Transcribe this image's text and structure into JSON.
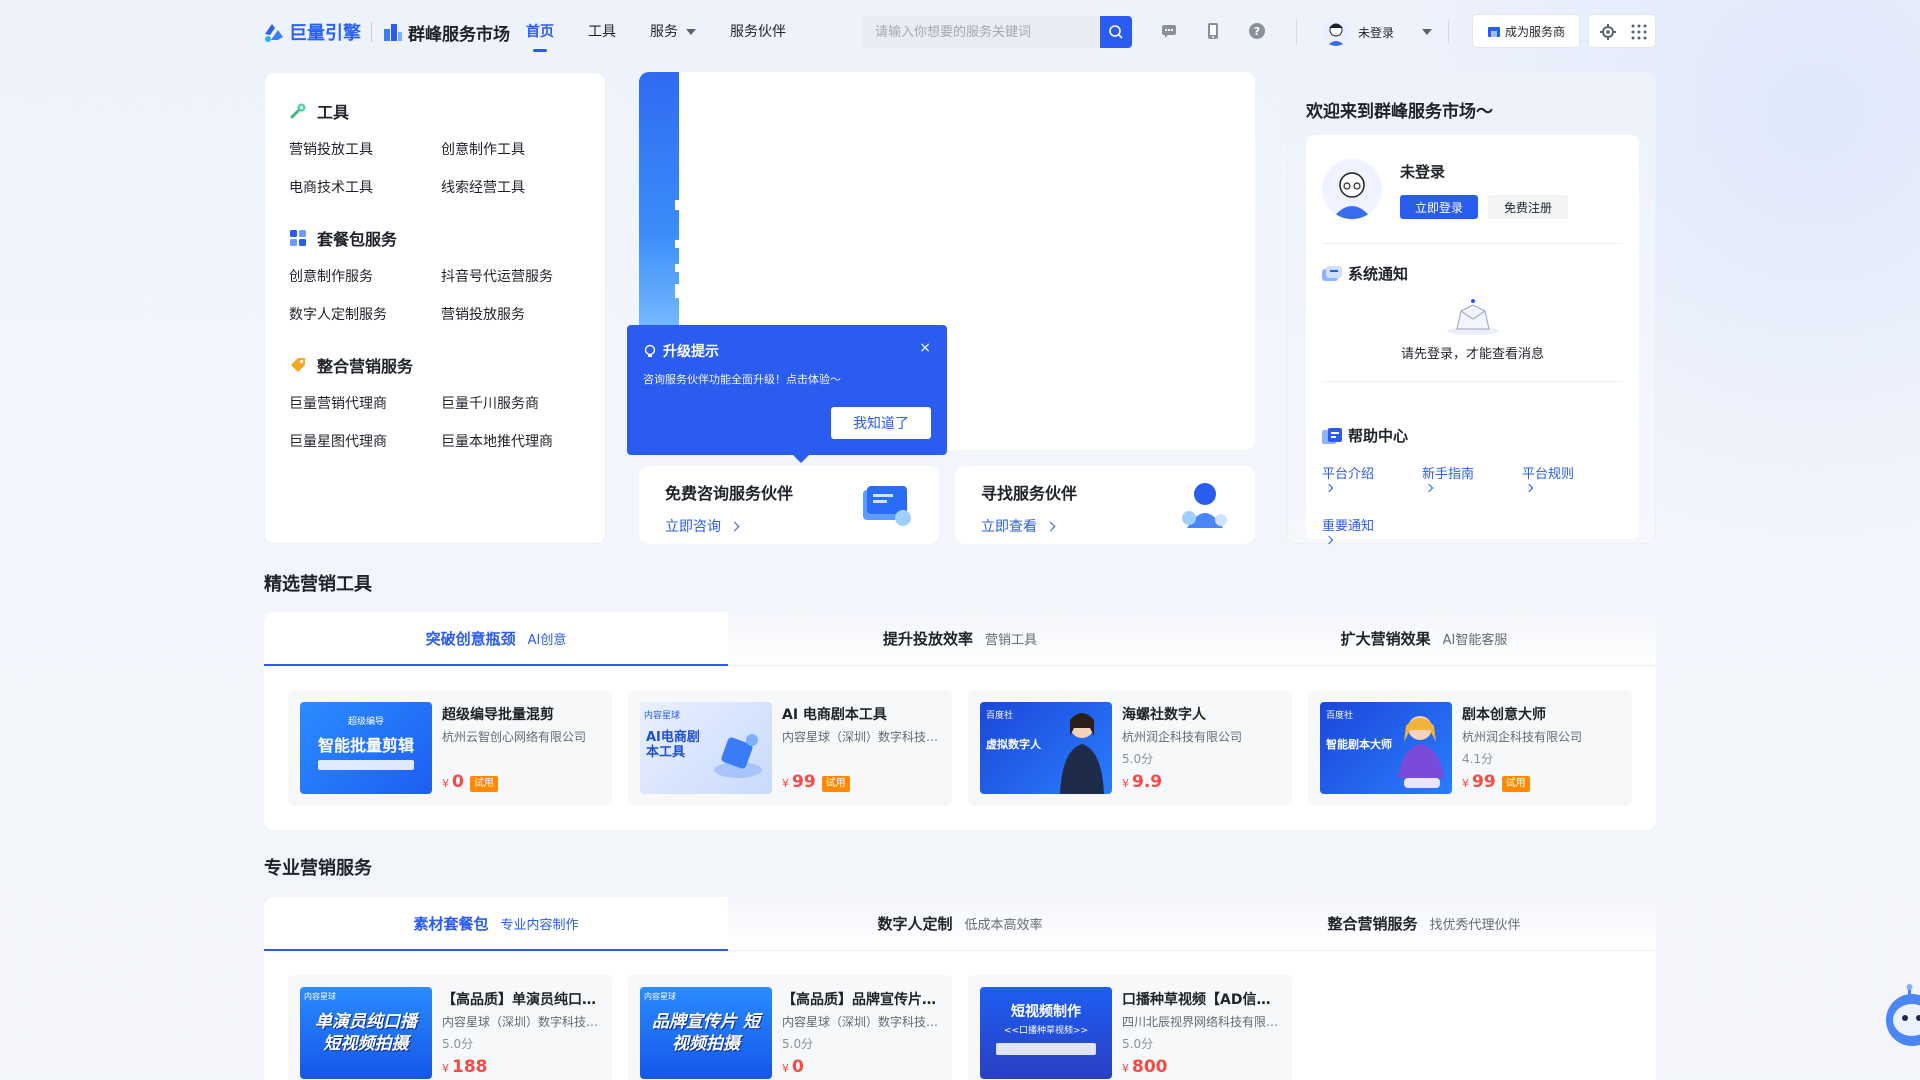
{
  "header": {
    "logo_text": "巨量引擎",
    "brand_text": "群峰服务市场",
    "nav": [
      {
        "label": "首页",
        "active": true
      },
      {
        "label": "工具",
        "active": false
      },
      {
        "label": "服务",
        "active": false,
        "dropdown": true
      },
      {
        "label": "服务伙伴",
        "active": false
      }
    ],
    "search_placeholder": "请输入你想要的服务关键词",
    "icons": [
      "message-icon",
      "phone-icon",
      "help-icon"
    ],
    "user_label": "未登录",
    "become_provider": "成为服务商",
    "accent": "#2a5cf0"
  },
  "left_menu": {
    "sections": [
      {
        "title": "工具",
        "icon": "tool-icon",
        "items": [
          "营销投放工具",
          "创意制作工具",
          "电商技术工具",
          "线索经营工具"
        ]
      },
      {
        "title": "套餐包服务",
        "icon": "grid-icon",
        "items": [
          "创意制作服务",
          "抖音号代运营服务",
          "数字人定制服务",
          "营销投放服务"
        ]
      },
      {
        "title": "整合营销服务",
        "icon": "tag-icon",
        "items": [
          "巨量营销代理商",
          "巨量千川服务商",
          "巨量星图代理商",
          "巨量本地推代理商"
        ]
      }
    ]
  },
  "popup": {
    "title": "升级提示",
    "text": "咨询服务伙伴功能全面升级！点击体验～",
    "button": "我知道了",
    "close": "×"
  },
  "promo_cards": [
    {
      "title": "免费咨询服务伙伴",
      "link": "立即咨询"
    },
    {
      "title": "寻找服务伙伴",
      "link": "立即查看"
    }
  ],
  "welcome": {
    "title": "欢迎来到群峰服务市场～",
    "user_name": "未登录",
    "login": "立即登录",
    "register": "免费注册",
    "notice_title": "系统通知",
    "notice_empty": "请先登录，才能查看消息",
    "help_title": "帮助中心",
    "help_links": [
      "平台介绍",
      "新手指南",
      "平台规则",
      "重要通知"
    ]
  },
  "tools_section": {
    "title": "精选营销工具",
    "tabs": [
      {
        "label": "突破创意瓶颈",
        "sub": "AI创意",
        "active": true
      },
      {
        "label": "提升投放效率",
        "sub": "营销工具",
        "active": false
      },
      {
        "label": "扩大营销效果",
        "sub": "AI智能客服",
        "active": false
      }
    ],
    "cards": [
      {
        "title": "超级编导批量混剪",
        "company": "杭州云智创心网络有限公司",
        "rating": "",
        "price": "0",
        "trial": "试用",
        "thumb_text": "智能批量剪辑",
        "thumb_top": "超级编导"
      },
      {
        "title": "AI 电商剧本工具",
        "company": "内容星球（深圳）数字科技有限公司",
        "rating": "",
        "price": "99",
        "trial": "试用",
        "thumb_text": "AI电商剧本工具",
        "thumb_top": "内容星球"
      },
      {
        "title": "海螺社数字人",
        "company": "杭州润企科技有限公司",
        "rating": "5.0分",
        "price": "9.9",
        "trial": "",
        "thumb_text": "虚拟数字人",
        "thumb_top": "百度社"
      },
      {
        "title": "剧本创意大师",
        "company": "杭州润企科技有限公司",
        "rating": "4.1分",
        "price": "99",
        "trial": "试用",
        "thumb_text": "智能剧本大师",
        "thumb_top": "百度社"
      }
    ]
  },
  "services_section": {
    "title": "专业营销服务",
    "tabs": [
      {
        "label": "素材套餐包",
        "sub": "专业内容制作",
        "active": true
      },
      {
        "label": "数字人定制",
        "sub": "低成本高效率",
        "active": false
      },
      {
        "label": "整合营销服务",
        "sub": "找优秀代理伙伴",
        "active": false
      }
    ],
    "cards": [
      {
        "title": "【高品质】单演员纯口播短视频拍摄",
        "company": "内容星球（深圳）数字科技有限公司",
        "rating": "5.0分",
        "price": "188",
        "thumb_text": "单演员纯口播 短视频拍摄",
        "thumb_top": "内容星球"
      },
      {
        "title": "【高品质】品牌宣传片短视频拍摄",
        "company": "内容星球（深圳）数字科技有限公司",
        "rating": "5.0分",
        "price": "0",
        "thumb_text": "品牌宣传片 短视频拍摄",
        "thumb_top": "内容星球"
      },
      {
        "title": "口播种草视频【AD信息流】",
        "company": "四川北辰视界网络科技有限公司",
        "rating": "5.0分",
        "price": "800",
        "thumb_text": "短视频制作",
        "thumb_top": "<<口播种草视频>>"
      }
    ]
  },
  "currency": "¥"
}
